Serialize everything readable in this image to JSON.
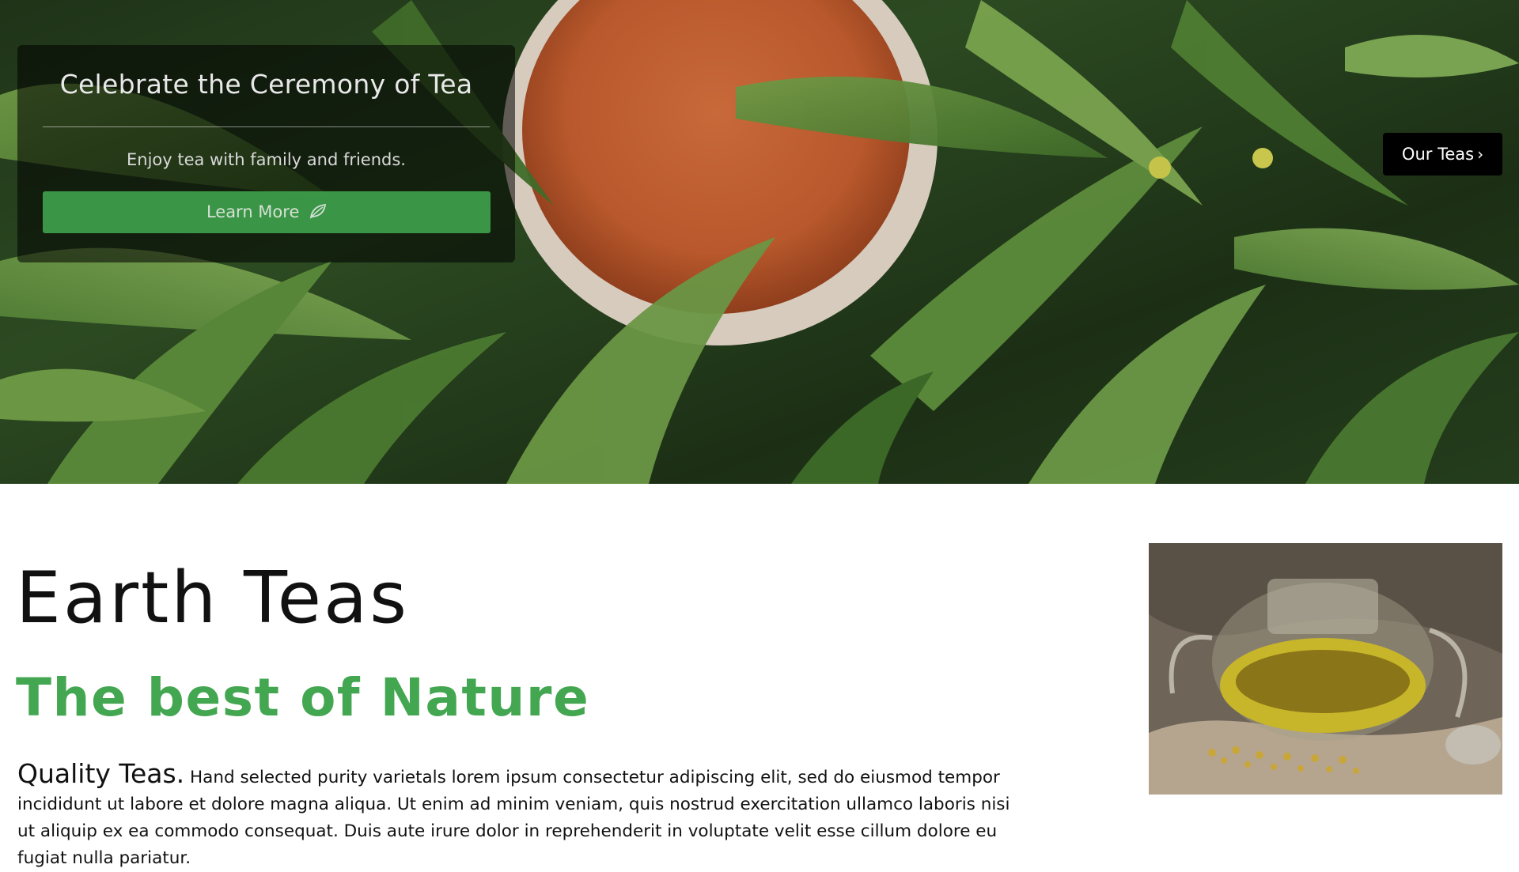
{
  "hero": {
    "title": "Celebrate the Ceremony of Tea",
    "subtitle": "Enjoy tea with family and friends.",
    "cta_label": "Learn More",
    "cta_icon": "leaf-icon",
    "nav_button_label": "Our Teas",
    "nav_button_icon": "chevron-right-icon"
  },
  "main": {
    "brand": "Earth Teas",
    "tagline": "The best of Nature",
    "lead": "Quality Teas.",
    "body": "Hand selected purity varietals lorem ipsum consectetur adipiscing elit, sed do eiusmod tempor incididunt ut labore et dolore magna aliqua. Ut enim ad minim veniam, quis nostrud exercitation ullamco laboris nisi ut aliquip ex ea commodo consequat. Duis aute irure dolor in reprehenderit in voluptate velit esse cillum dolore eu fugiat nulla pariatur."
  },
  "colors": {
    "accent_green": "#43a650",
    "button_green": "#3fa34d",
    "card_overlay": "rgba(0,0,0,0.55)",
    "nav_button_bg": "#000000"
  }
}
